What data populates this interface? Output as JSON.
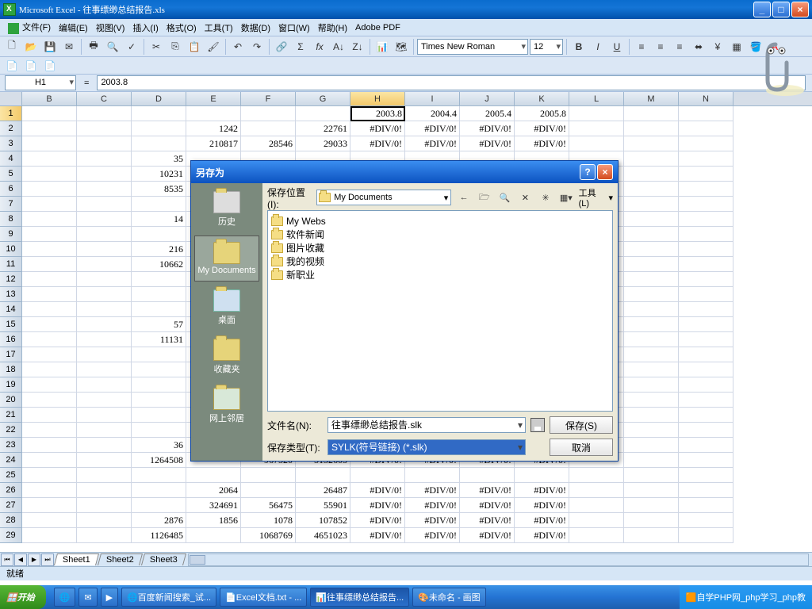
{
  "window": {
    "title": "Microsoft Excel - 往事缥缈总结报告.xls"
  },
  "menu": [
    "文件(F)",
    "编辑(E)",
    "视图(V)",
    "插入(I)",
    "格式(O)",
    "工具(T)",
    "数据(D)",
    "窗口(W)",
    "帮助(H)",
    "Adobe PDF"
  ],
  "toolbar": {
    "font": "Times New Roman",
    "size": "12"
  },
  "namebox": "H1",
  "formula_fx": "=",
  "formula_text": "2003.8",
  "columns": [
    "B",
    "C",
    "D",
    "E",
    "F",
    "G",
    "H",
    "I",
    "J",
    "K",
    "L",
    "M",
    "N"
  ],
  "active_col": "H",
  "rows": [
    {
      "n": 1,
      "c": {
        "H": "2003.8",
        "I": "2004.4",
        "J": "2005.4",
        "K": "2005.8"
      }
    },
    {
      "n": 2,
      "c": {
        "E": "1242",
        "G": "22761",
        "H": "#DIV/0!",
        "I": "#DIV/0!",
        "J": "#DIV/0!",
        "K": "#DIV/0!"
      }
    },
    {
      "n": 3,
      "c": {
        "E": "210817",
        "F": "28546",
        "G": "29033",
        "H": "#DIV/0!",
        "I": "#DIV/0!",
        "J": "#DIV/0!",
        "K": "#DIV/0!"
      }
    },
    {
      "n": 4,
      "c": {
        "D": "35"
      }
    },
    {
      "n": 5,
      "c": {
        "D": "10231"
      }
    },
    {
      "n": 6,
      "c": {
        "D": "8535"
      }
    },
    {
      "n": 7,
      "c": {}
    },
    {
      "n": 8,
      "c": {
        "D": "14"
      }
    },
    {
      "n": 9,
      "c": {}
    },
    {
      "n": 10,
      "c": {
        "D": "216"
      }
    },
    {
      "n": 11,
      "c": {
        "D": "10662"
      }
    },
    {
      "n": 12,
      "c": {}
    },
    {
      "n": 13,
      "c": {}
    },
    {
      "n": 14,
      "c": {}
    },
    {
      "n": 15,
      "c": {
        "D": "57"
      }
    },
    {
      "n": 16,
      "c": {
        "D": "11131"
      }
    },
    {
      "n": 17,
      "c": {}
    },
    {
      "n": 18,
      "c": {}
    },
    {
      "n": 19,
      "c": {}
    },
    {
      "n": 20,
      "c": {}
    },
    {
      "n": 21,
      "c": {}
    },
    {
      "n": 22,
      "c": {}
    },
    {
      "n": 23,
      "c": {
        "D": "36"
      }
    },
    {
      "n": 24,
      "c": {
        "D": "1264508",
        "E": "",
        "F": "967520",
        "G": "5132605",
        "H": "#DIV/0!",
        "I": "#DIV/0!",
        "J": "#DIV/0!",
        "K": "#DIV/0!"
      }
    },
    {
      "n": 25,
      "c": {}
    },
    {
      "n": 26,
      "c": {
        "E": "2064",
        "G": "26487",
        "H": "#DIV/0!",
        "I": "#DIV/0!",
        "J": "#DIV/0!",
        "K": "#DIV/0!"
      }
    },
    {
      "n": 27,
      "c": {
        "E": "324691",
        "F": "56475",
        "G": "55901",
        "H": "#DIV/0!",
        "I": "#DIV/0!",
        "J": "#DIV/0!",
        "K": "#DIV/0!"
      }
    },
    {
      "n": 28,
      "c": {
        "D": "2876",
        "E": "1856",
        "F": "1078",
        "G": "107852",
        "H": "#DIV/0!",
        "I": "#DIV/0!",
        "J": "#DIV/0!",
        "K": "#DIV/0!"
      }
    },
    {
      "n": 29,
      "c": {
        "D": "1126485",
        "F": "1068769",
        "G": "4651023",
        "H": "#DIV/0!",
        "I": "#DIV/0!",
        "J": "#DIV/0!",
        "K": "#DIV/0!"
      }
    }
  ],
  "sheets": [
    "Sheet1",
    "Sheet2",
    "Sheet3"
  ],
  "status": "就绪",
  "dialog": {
    "title": "另存为",
    "loc_label": "保存位置(I):",
    "loc_value": "My Documents",
    "tools": "工具(L)",
    "sidebar": [
      "历史",
      "My Documents",
      "桌面",
      "收藏夹",
      "网上邻居"
    ],
    "files": [
      "My Webs",
      "软件新闻",
      "图片收藏",
      "我的视频",
      "新职业"
    ],
    "fname_label": "文件名(N):",
    "fname_value": "往事缥缈总结报告.slk",
    "ftype_label": "保存类型(T):",
    "ftype_value": "SYLK(符号链接) (*.slk)",
    "save_btn": "保存(S)",
    "cancel_btn": "取消"
  },
  "taskbar": {
    "start": "开始",
    "tasks": [
      "百度新闻搜索_试...",
      "Excel文档.txt - ...",
      "往事缥缈总结报告...",
      "未命名 - 画图"
    ],
    "tray": "自学PHP网_php学习_php教"
  }
}
